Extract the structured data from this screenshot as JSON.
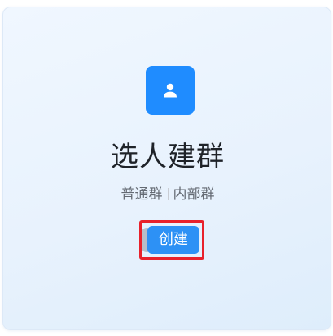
{
  "card": {
    "icon": "user-icon",
    "title": "选人建群",
    "subtitle": {
      "left": "普通群",
      "right": "内部群"
    },
    "create_button_label": "创建"
  },
  "colors": {
    "accent": "#1f8cff",
    "button": "#2d91f5",
    "highlight_border": "#e8212b",
    "title_text": "#1f2329",
    "subtitle_text": "#646a73"
  }
}
